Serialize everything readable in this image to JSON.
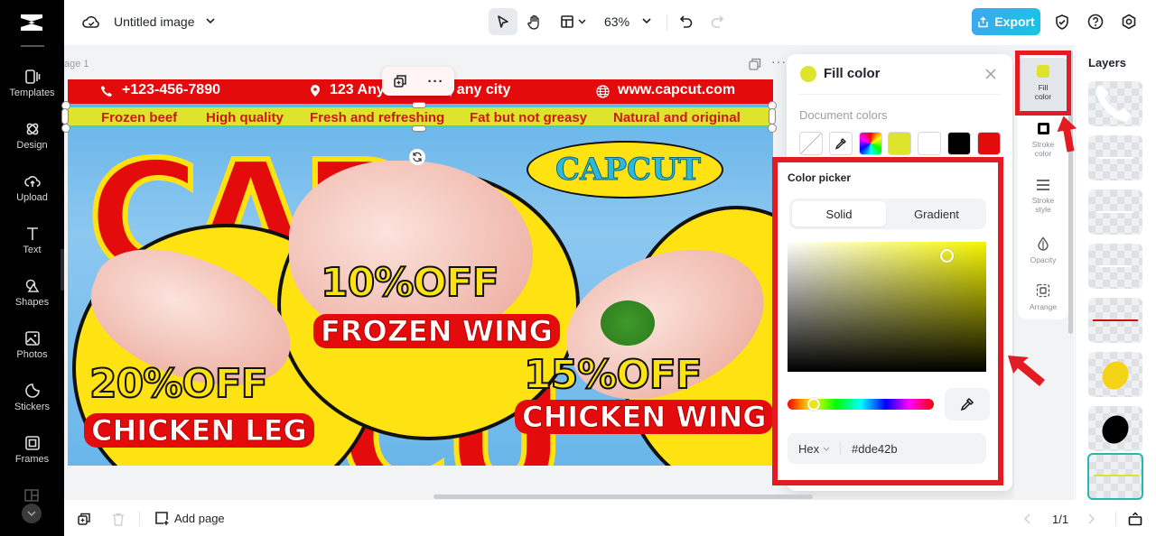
{
  "app": {
    "logo": "capcut-logo"
  },
  "topbar": {
    "title": "Untitled image",
    "zoom": "63%",
    "export_label": "Export"
  },
  "rail": {
    "items": [
      {
        "label": "Templates",
        "icon": "templates-icon"
      },
      {
        "label": "Design",
        "icon": "design-icon"
      },
      {
        "label": "Upload",
        "icon": "upload-icon"
      },
      {
        "label": "Text",
        "icon": "text-icon"
      },
      {
        "label": "Shapes",
        "icon": "shapes-icon"
      },
      {
        "label": "Photos",
        "icon": "photos-icon"
      },
      {
        "label": "Stickers",
        "icon": "stickers-icon"
      },
      {
        "label": "Frames",
        "icon": "frames-icon"
      }
    ]
  },
  "canvas": {
    "page_label": "age 1",
    "poster": {
      "phone": "+123-456-7890",
      "address": "123 Anywhere St., any city",
      "website": "www.capcut.com",
      "taglines": [
        "Frozen beef",
        "High quality",
        "Fresh and refreshing",
        "Fat but not greasy",
        "Natural and original"
      ],
      "brand": "CAPCUT",
      "bg_word_top": "CAP",
      "bg_word_bottom": "CU",
      "deals": [
        {
          "discount": "10%OFF",
          "name": "FROZEN WING"
        },
        {
          "discount": "20%OFF",
          "name": "CHICKEN LEG"
        },
        {
          "discount": "15%OFF",
          "name": "CHICKEN WING"
        }
      ]
    }
  },
  "fill_panel": {
    "title": "Fill color",
    "current_color": "#dde42b",
    "document_colors_label": "Document colors",
    "document_colors": [
      "none",
      "eyedropper",
      "rainbow",
      "#dde42b",
      "#ffffff",
      "#000000",
      "#e30b0b"
    ],
    "picker": {
      "title": "Color picker",
      "tabs": [
        "Solid",
        "Gradient"
      ],
      "active_tab": "Solid",
      "format": "Hex",
      "hex_value": "#dde42b"
    }
  },
  "props": [
    {
      "label": "Fill color",
      "icon": "fill-color-icon"
    },
    {
      "label": "Stroke color",
      "icon": "stroke-color-icon"
    },
    {
      "label": "Stroke style",
      "icon": "stroke-style-icon"
    },
    {
      "label": "Opacity",
      "icon": "opacity-icon"
    },
    {
      "label": "Arrange",
      "icon": "arrange-icon"
    }
  ],
  "layers": {
    "title": "Layers",
    "items": [
      "phone-icon-layer",
      "text-layer",
      "text-layer",
      "text-layer",
      "red-line-layer",
      "yellow-ellipse-layer",
      "black-ellipse-layer",
      "yellow-line-layer"
    ]
  },
  "bottom": {
    "add_page": "Add page",
    "page_indicator": "1/1"
  },
  "colors": {
    "accent": "#1fbfe3",
    "highlight": "#e31b23",
    "selected_layer": "#2bb5b0"
  }
}
